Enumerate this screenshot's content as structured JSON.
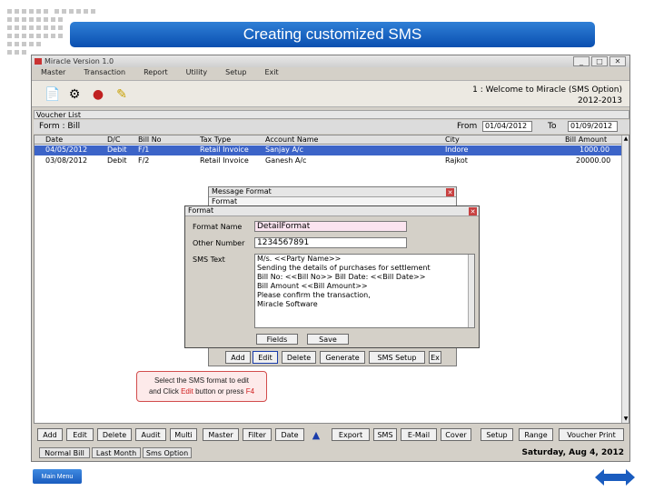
{
  "slide": {
    "title": "Creating customized SMS",
    "main_menu": "Main Menu"
  },
  "app": {
    "title": "Miracle Version 1.0",
    "menu": [
      "Master",
      "Transaction",
      "Report",
      "Utility",
      "Setup",
      "Exit"
    ],
    "welcome_line1": "1 : Welcome to Miracle (SMS Option)",
    "welcome_line2": "2012-2013"
  },
  "voucher_list": {
    "title": "Voucher List",
    "form_label": "Form : Bill",
    "from_label": "From",
    "from_value": "01/04/2012",
    "to_label": "To",
    "to_value": "01/09/2012",
    "columns": [
      "Date",
      "D/C",
      "Bill No",
      "Tax Type",
      "Account Name",
      "City",
      "Bill Amount"
    ],
    "rows": [
      [
        "04/05/2012",
        "Debit",
        "F/1",
        "Retail Invoice",
        "Sanjay A/c",
        "Indore",
        "1000.00"
      ],
      [
        "03/08/2012",
        "Debit",
        "F/2",
        "Retail Invoice",
        "Ganesh A/c",
        "Rajkot",
        "20000.00"
      ]
    ]
  },
  "bottom_buttons": [
    "Add",
    "Edit",
    "Delete",
    "Audit",
    "Multi",
    "Master",
    "Filter",
    "Date",
    "Export",
    "SMS",
    "E-Mail",
    "Cover",
    "Setup",
    "Range",
    "Voucher Print"
  ],
  "status_bar": {
    "tabs": [
      "Normal Bill",
      "Last Month",
      "Sms Option"
    ],
    "date": "Saturday, Aug 4, 2012"
  },
  "message_window": {
    "title": "Message Format",
    "subtitle": "Format",
    "buttons": [
      "Add",
      "Edit",
      "Delete",
      "Generate",
      "SMS Setup",
      "Ex"
    ]
  },
  "format_dialog": {
    "title": "Format",
    "format_name_label": "Format Name",
    "format_name_value": "DetailFormat",
    "other_number_label": "Other Number",
    "other_number_value": "1234567891",
    "sms_text_label": "SMS Text",
    "sms_lines": [
      "M/s. <<Party Name>>",
      "Sending the details of purchases for settlement",
      "Bill No: <<Bill No>> Bill Date: <<Bill Date>>",
      "Bill Amount <<Bill Amount>>",
      "Please confirm the transaction,",
      "Miracle Software"
    ],
    "buttons": [
      "Fields",
      "Save"
    ]
  },
  "callout": {
    "line1": "Select the SMS format to edit",
    "line2_pre": "and Click ",
    "edit": "Edit",
    "line2_mid": " button or press ",
    "key": "F4"
  }
}
